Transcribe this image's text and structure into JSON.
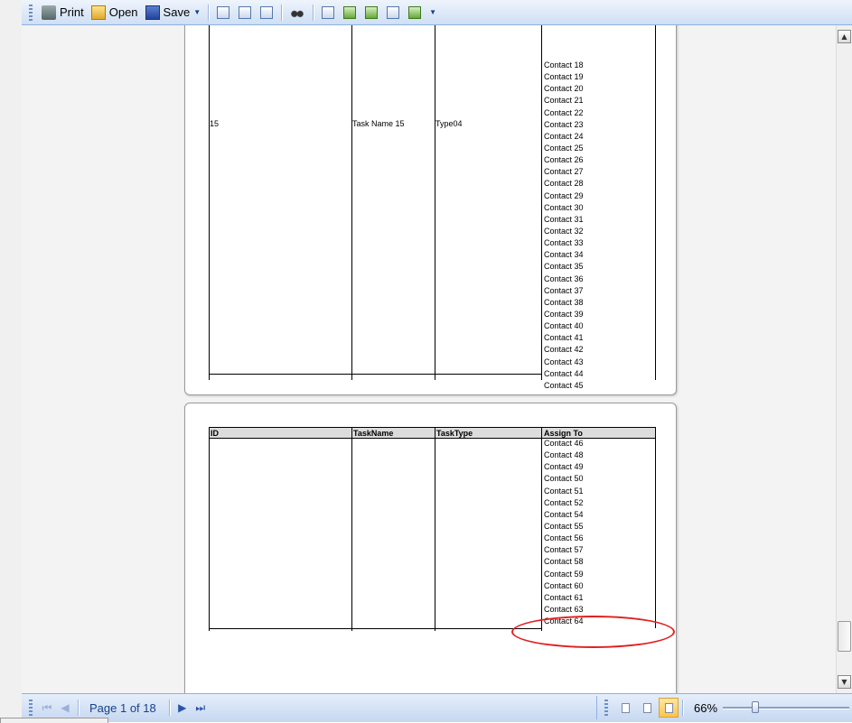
{
  "toolbar": {
    "print_label": "Print",
    "open_label": "Open",
    "save_label": "Save"
  },
  "page1": {
    "row_id": "15",
    "row_taskname": "Task Name 15",
    "row_tasktype": "Type04",
    "contacts": [
      "Contact 18",
      "Contact 19",
      "Contact 20",
      "Contact 21",
      "Contact 22",
      "Contact 23",
      "Contact 24",
      "Contact 25",
      "Contact 26",
      "Contact 27",
      "Contact 28",
      "Contact 29",
      "Contact 30",
      "Contact 31",
      "Contact 32",
      "Contact 33",
      "Contact 34",
      "Contact 35",
      "Contact 36",
      "Contact 37",
      "Contact 38",
      "Contact 39",
      "Contact 40",
      "Contact 41",
      "Contact 42",
      "Contact 43",
      "Contact 44",
      "Contact 45"
    ]
  },
  "page2": {
    "headers": {
      "id": "ID",
      "taskname": "TaskName",
      "tasktype": "TaskType",
      "assign": "Assign To"
    },
    "contacts": [
      "Contact 46",
      "Contact 48",
      "Contact 49",
      "Contact 50",
      "Contact 51",
      "Contact 52",
      "Contact 54",
      "Contact 55",
      "Contact 56",
      "Contact 57",
      "Contact 58",
      "Contact 59",
      "Contact 60",
      "Contact 61",
      "Contact 63",
      "Contact 64"
    ]
  },
  "status": {
    "page_text": "Page 1 of 18",
    "zoom_text": "66%",
    "zoom_level_percent": 66
  },
  "colors": {
    "annotation": "#e02020",
    "accent": "#15428b"
  }
}
